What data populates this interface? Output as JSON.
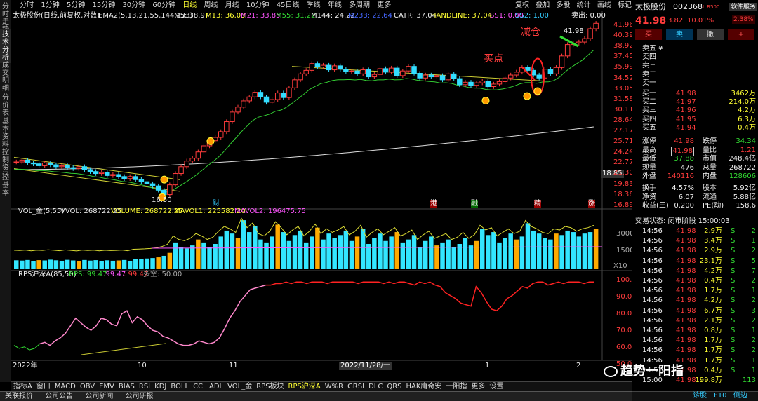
{
  "left_tabs": [
    "分时走势",
    "技术分析",
    "成交明细",
    "分价表",
    "基本资料",
    "控制资讯",
    "控基本"
  ],
  "period_tabs": [
    "分时",
    "1分钟",
    "5分钟",
    "15分钟",
    "30分钟",
    "60分钟",
    "日线",
    "周线",
    "月线",
    "10分钟",
    "45日线",
    "季线",
    "年线",
    "多周期",
    "更多"
  ],
  "toolbar": [
    "复权",
    "叠加",
    "多股",
    "统计",
    "画线",
    "标记"
  ],
  "legend": {
    "name": "太极股份(日线,前复权,对数)",
    "ema": "EMA2(5,13,21,55,144,233)",
    "m5": "M5: 38.97",
    "m13": "M13: 36.03",
    "m21": "M21: 33.85",
    "m55": "M55: 31.22",
    "m144": "M144: 24.22",
    "m233": "M233: 22.64",
    "catr": "CATR: 37.04",
    "handline": "HANDLINE: 37.04",
    "ss1": "SS1: 0.00",
    "ss2": "SS2: 1.00",
    "sell": "卖出: 0.00"
  },
  "price_axis": [
    "41.96",
    "40.39",
    "38.92",
    "37.45",
    "35.99",
    "34.52",
    "33.05",
    "31.58",
    "30.11",
    "28.64",
    "27.17",
    "25.71",
    "24.24",
    "22.77",
    "21.30",
    "19.83",
    "18.36",
    "16.89"
  ],
  "current_price_tag": "18.85",
  "annotations": {
    "jiancang": "减仓",
    "maidian": "买点",
    "high": "41.98",
    "low": "16.50"
  },
  "event_marks": [
    "财",
    "港",
    "融",
    "精",
    "涨"
  ],
  "vol_legend": {
    "name": "VOL_金(5,55)",
    "vvol": "VVOL: 268722.25",
    "volume": "VOLUME: 268722.25",
    "mavol1": "MAVOL1: 225582.20",
    "mavol2": "MAVOL2: 196475.75"
  },
  "vol_axis": [
    "30000",
    "15000",
    "X10"
  ],
  "rps_legend": {
    "name": "RPS沪深A(85,50)",
    "rps": "RPS: 99.47",
    "val": ": 99.47",
    "val2": ": 99.47",
    "kong": "多空: 50.00"
  },
  "rps_axis": [
    "100.0",
    "90.00",
    "80.00",
    "70.00",
    "60.00",
    "50.00"
  ],
  "date_labels": [
    "2022年",
    "10",
    "11",
    "2022/11/28/一",
    "1",
    "2"
  ],
  "bottom_tabs": [
    "指标A",
    "窗口",
    "MACD",
    "OBV",
    "EMV",
    "BIAS",
    "RSI",
    "KDJ",
    "BOLL",
    "CCI",
    "ADL",
    "VOL_金",
    "RPS板块",
    "RPS沪深A",
    "W%R",
    "GRSI",
    "DLC",
    "QRS",
    "HAK庸奇安",
    "一阳指",
    "更多",
    "设置"
  ],
  "status_bar": [
    "关联报价",
    "公司公告",
    "公司新闻",
    "公司研报"
  ],
  "panel": {
    "name": "太极股份",
    "code": "002368",
    "tag": "L R500",
    "software": "软件服务",
    "sw_pct": "2.38%",
    "price": "41.98",
    "change": "3.82",
    "pct": "10.01%",
    "buttons": [
      "买",
      "卖",
      "撤",
      "+"
    ],
    "sell": [
      {
        "label": "卖五 ¥",
        "price": "",
        "vol": ""
      },
      {
        "label": "卖四",
        "price": "",
        "vol": ""
      },
      {
        "label": "卖三",
        "price": "",
        "vol": ""
      },
      {
        "label": "卖二",
        "price": "",
        "vol": ""
      },
      {
        "label": "卖一",
        "price": "",
        "vol": ""
      }
    ],
    "buy": [
      {
        "label": "买一",
        "price": "41.98",
        "vol": "3462万"
      },
      {
        "label": "买二",
        "price": "41.97",
        "vol": "214.0万"
      },
      {
        "label": "买三",
        "price": "41.96",
        "vol": "4.2万"
      },
      {
        "label": "买四",
        "price": "41.95",
        "vol": "6.3万"
      },
      {
        "label": "买五",
        "price": "41.94",
        "vol": "0.4万"
      }
    ],
    "stats": [
      [
        "涨停",
        "41.98",
        "跌停",
        "34.34"
      ],
      [
        "最高",
        "41.98",
        "量比",
        "1.21"
      ],
      [
        "最低",
        "37.88",
        "市值",
        "248.4亿"
      ],
      [
        "现量",
        "476",
        "总量",
        "268722"
      ],
      [
        "外盘",
        "140116",
        "内盘",
        "128606"
      ],
      [
        "换手",
        "4.57%",
        "股本",
        "5.92亿"
      ],
      [
        "净资",
        "6.07",
        "流通",
        "5.88亿"
      ],
      [
        "收益(三)",
        "0.200",
        "PE(动)",
        "158.6"
      ]
    ],
    "trade_status": "交易状态: 闭市阶段 15:00:03",
    "ticks": [
      [
        "14:56",
        "41.98",
        "2.9万",
        "S",
        "2"
      ],
      [
        "14:56",
        "41.98",
        "3.4万",
        "S",
        "1"
      ],
      [
        "14:56",
        "41.98",
        "2.9万",
        "S",
        "2"
      ],
      [
        "14:56",
        "41.98",
        "23.1万",
        "S",
        "5"
      ],
      [
        "14:56",
        "41.98",
        "4.2万",
        "S",
        "7"
      ],
      [
        "14:56",
        "41.98",
        "0.4万",
        "S",
        "2"
      ],
      [
        "14:56",
        "41.98",
        "1.7万",
        "S",
        "1"
      ],
      [
        "14:56",
        "41.98",
        "4.2万",
        "S",
        "2"
      ],
      [
        "14:56",
        "41.98",
        "6.7万",
        "S",
        "3"
      ],
      [
        "14:56",
        "41.98",
        "2.1万",
        "S",
        "2"
      ],
      [
        "14:56",
        "41.98",
        "0.8万",
        "S",
        "1"
      ],
      [
        "14:56",
        "41.98",
        "1.7万",
        "S",
        "2"
      ],
      [
        "14:56",
        "41.98",
        "1.7万",
        "S",
        "2"
      ],
      [
        "14:56",
        "41.98",
        "1.7万",
        "S",
        "1"
      ],
      [
        "14:57",
        "41.98",
        "0.4万",
        "S",
        "1"
      ],
      [
        "15:00",
        "41.98",
        "199.8万",
        "",
        "113"
      ]
    ],
    "footer": [
      "诊股",
      "F10",
      "侧边"
    ]
  },
  "watermark": "趋势一阳指",
  "chart_data": {
    "type": "candlestick",
    "scale": "log",
    "ylim": [
      16.5,
      42.5
    ],
    "closes": [
      20.1,
      20.3,
      20.0,
      19.9,
      19.7,
      20.0,
      19.8,
      19.6,
      19.7,
      19.5,
      19.4,
      19.6,
      19.3,
      19.1,
      18.9,
      19.0,
      18.7,
      18.8,
      18.6,
      18.4,
      18.6,
      18.3,
      18.1,
      17.9,
      17.7,
      17.3,
      16.9,
      17.8,
      18.9,
      19.6,
      20.2,
      20.5,
      21.2,
      21.9,
      22.5,
      22.9,
      23.6,
      24.9,
      26.2,
      26.9,
      27.8,
      28.4,
      29.1,
      28.4,
      27.6,
      28.0,
      29.0,
      28.3,
      29.8,
      31.1,
      32.1,
      32.7,
      33.9,
      33.3,
      33.6,
      32.8,
      33.5,
      32.9,
      32.5,
      32.6,
      32.1,
      32.8,
      31.6,
      32.0,
      33.0,
      32.4,
      33.1,
      31.8,
      32.6,
      33.4,
      32.2,
      31.4,
      31.9,
      31.6,
      31.8,
      31.1,
      32.1,
      31.3,
      30.3,
      30.7,
      30.2,
      30.6,
      30.9,
      30.0,
      30.4,
      30.8,
      31.4,
      31.9,
      32.4,
      33.2,
      32.7,
      31.9,
      31.4,
      32.9,
      32.1,
      33.2,
      35.3,
      37.5,
      37.8,
      38.0,
      38.7,
      40.8,
      41.98
    ],
    "vol_values": [
      6000,
      5800,
      6200,
      5500,
      6100,
      5900,
      6400,
      6000,
      5600,
      6300,
      5900,
      5400,
      6200,
      5800,
      6100,
      5500,
      6000,
      5700,
      5900,
      6200,
      5600,
      6800,
      7000,
      7200,
      7500,
      8000,
      9000,
      11000,
      18000,
      15000,
      14000,
      16000,
      20000,
      18000,
      15000,
      17000,
      22000,
      26000,
      24000,
      21000,
      33000,
      25000,
      29000,
      20000,
      18000,
      22000,
      30000,
      25000,
      19000,
      23000,
      26000,
      18000,
      22000,
      28000,
      20000,
      24000,
      21000,
      23000,
      26000,
      19000,
      22000,
      27000,
      17000,
      21000,
      24000,
      19000,
      22000,
      25000,
      18000,
      20000,
      23000,
      15000,
      19000,
      22000,
      16000,
      18000,
      20000,
      15000,
      17000,
      21000,
      16000,
      19000,
      27000,
      23000,
      25000,
      18000,
      21000,
      24000,
      20000,
      22000,
      31000,
      26000,
      24000,
      21000,
      20000,
      24000,
      23000,
      26000,
      25000,
      22000,
      24000,
      25000,
      27000
    ],
    "rps_values": [
      57,
      55,
      56,
      54,
      55,
      58,
      59,
      57,
      60,
      62,
      65,
      70,
      75,
      72,
      69,
      67,
      70,
      75,
      74,
      71,
      70,
      78,
      80,
      72,
      76,
      74,
      70,
      67,
      66,
      63,
      62,
      60,
      58,
      57,
      57,
      58,
      60,
      59,
      58,
      59,
      62,
      68,
      75,
      80,
      86,
      90,
      94,
      95,
      96,
      97,
      97,
      98,
      98,
      99,
      98,
      99,
      99,
      98,
      99,
      99,
      99,
      98,
      99,
      99,
      99,
      99,
      99,
      98,
      99,
      99,
      99,
      99,
      98,
      99,
      98,
      99,
      99,
      98,
      97,
      99,
      98,
      99,
      97,
      96,
      92,
      90,
      88,
      85,
      84,
      83,
      96,
      92,
      86,
      81,
      80,
      83,
      88,
      90,
      93,
      96,
      95,
      98,
      99,
      99,
      97,
      98,
      99,
      98,
      99,
      99,
      99,
      98,
      99,
      99
    ]
  }
}
